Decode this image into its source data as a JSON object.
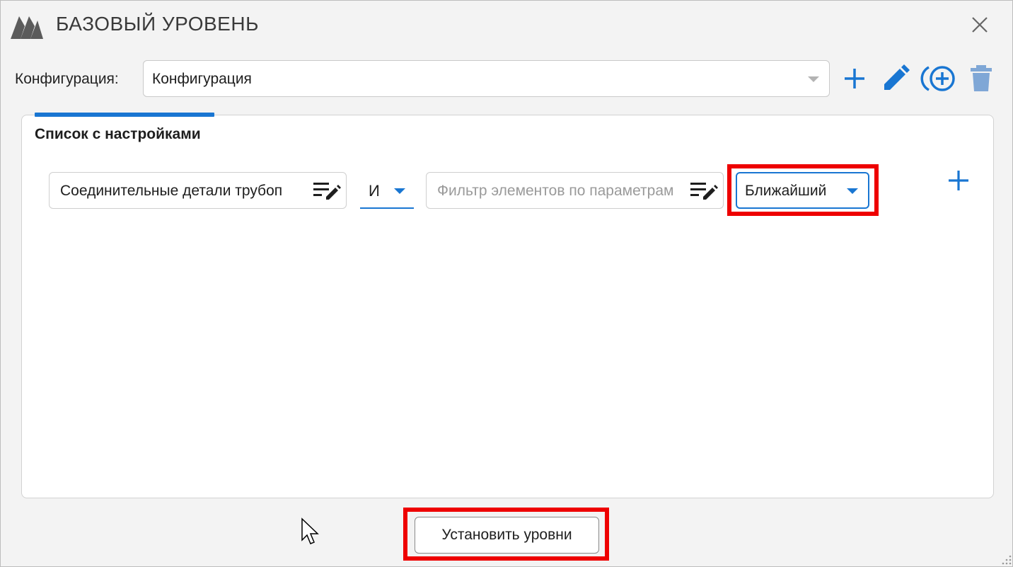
{
  "window": {
    "title": "БАЗОВЫЙ УРОВЕНЬ"
  },
  "config": {
    "label": "Конфигурация:",
    "value": "Конфигурация"
  },
  "toolbar": {
    "icons": [
      "plus-icon",
      "pencil-icon",
      "copy-add-icon",
      "trash-icon"
    ]
  },
  "panel": {
    "title": "Список с настройками",
    "row": {
      "category_value": "Соединительные детали трубоп",
      "operator": "И",
      "filter_placeholder": "Фильтр элементов по параметрам",
      "mode": "Ближайший"
    }
  },
  "footer": {
    "apply_label": "Установить уровни"
  },
  "colors": {
    "accent": "#1976d2",
    "highlight": "#ee0000",
    "disabled_icon": "#7fa7d6"
  }
}
